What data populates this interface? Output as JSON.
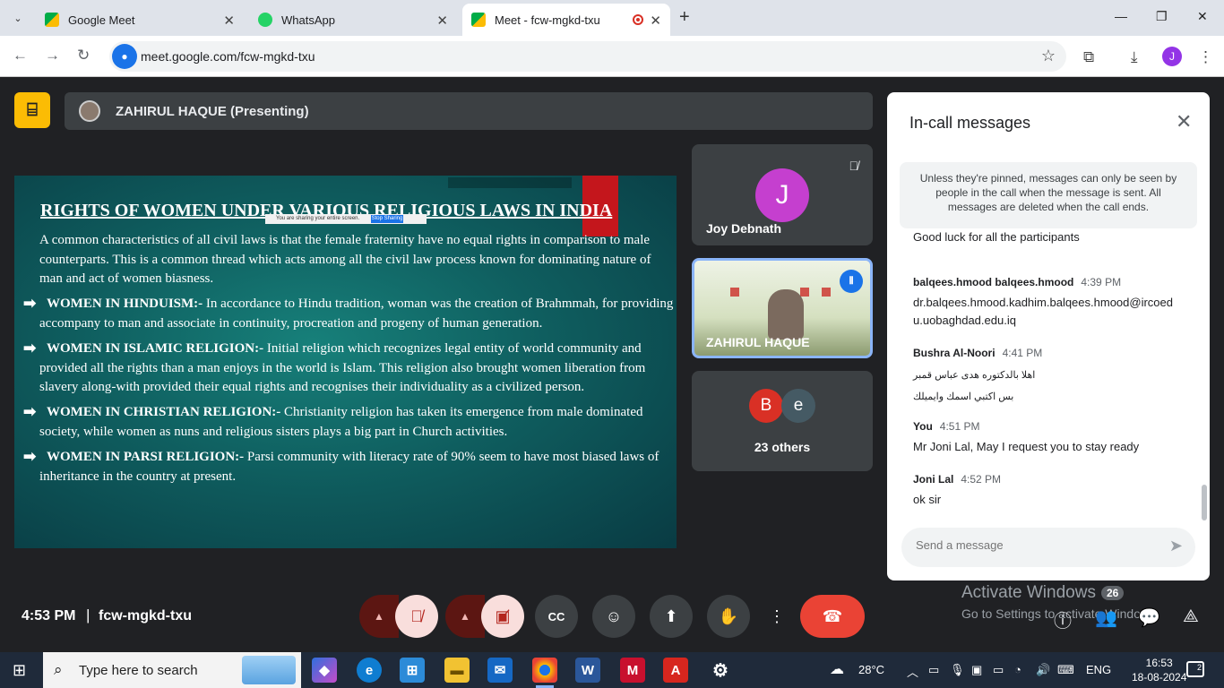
{
  "browser": {
    "tabs": [
      {
        "label": "Google Meet",
        "favicon_color": "#00ac47"
      },
      {
        "label": "WhatsApp",
        "favicon_color": "#25d366"
      },
      {
        "label": "Meet - fcw-mgkd-txu",
        "favicon_color": "#00ac47"
      }
    ],
    "url": "meet.google.com/fcw-mgkd-txu",
    "profile_initial": "J"
  },
  "meet": {
    "presenter_banner": "ZAHIRUL HAQUE (Presenting)",
    "slide": {
      "title": "RIGHTS OF WOMEN  UNDER VARIOUS RELIGIOUS LAWS IN INDIA",
      "share_bar_text": "You are sharing your entire screen.",
      "share_bar_button": "Stop Sharing",
      "intro": "A common characteristics of all civil laws is that the female fraternity have no equal rights in comparison to male counterparts. This is a common thread  which acts among all the civil law process known for dominating nature of man and act of women biasness.",
      "points": [
        {
          "heading": "WOMEN IN HINDUISM:-",
          "text": " In accordance to Hindu tradition, woman was the creation of Brahmmah, for providing accompany to man and associate in continuity, procreation and progeny of human generation."
        },
        {
          "heading": "WOMEN IN ISLAMIC RELIGION:-",
          "text": " Initial religion which recognizes legal entity of world community and provided all the rights than a man enjoys in the world is Islam. This religion also brought women liberation from slavery along-with provided their equal rights and recognises their individuality as a civilized person."
        },
        {
          "heading": "WOMEN IN CHRISTIAN RELIGION:-",
          "text": " Christianity religion has taken its emergence from male dominated society, while women as nuns  and religious sisters plays a big part in Church activities."
        },
        {
          "heading": "WOMEN IN PARSI RELIGION:-",
          "text": " Parsi community with literacy rate of 90% seem to have most biased laws of inheritance in the country at present."
        }
      ]
    },
    "participants": [
      {
        "name": "Joy Debnath",
        "initial": "J",
        "color": "#c53fcf"
      },
      {
        "name": "ZAHIRUL HAQUE"
      },
      {
        "name": "23 others",
        "avatars": [
          {
            "initial": "B",
            "color": "#d93025"
          },
          {
            "initial": "e",
            "color": "#455a64"
          }
        ]
      }
    ],
    "chat": {
      "title": "In-call messages",
      "notice": "Unless they're pinned, messages can only be seen by people in the call when the message is sent. All messages are deleted when the call ends.",
      "cut_off_message": "Good luck for all the participants",
      "messages": [
        {
          "sender": "balqees.hmood balqees.hmood",
          "time": "4:39 PM",
          "text": "dr.balqees.hmood.kadhim.balqees.hmood@ircoedu.uobaghdad.edu.iq"
        },
        {
          "sender": "Bushra Al-Noori",
          "time": "4:41 PM",
          "text": "اهلا بالدكتوره هدى عباس قمبر",
          "text2": "بس اكتبي اسمك وايميلك"
        },
        {
          "sender": "You",
          "time": "4:51 PM",
          "text": "Mr Joni Lal, May I request you to stay ready"
        },
        {
          "sender": "Joni Lal",
          "time": "4:52 PM",
          "text": "ok sir"
        }
      ],
      "input_placeholder": "Send a message"
    },
    "bottom": {
      "time": "4:53 PM",
      "separator": "|",
      "meeting_code": "fcw-mgkd-txu",
      "participant_count": "26"
    }
  },
  "windows": {
    "activate_title": "Activate Windows",
    "activate_sub": "Go to Settings to activate Windows.",
    "search_placeholder": "Type here to search",
    "weather": "28°C",
    "language": "ENG",
    "clock_time": "16:53",
    "clock_date": "18-08-2024",
    "notifications": "2"
  }
}
